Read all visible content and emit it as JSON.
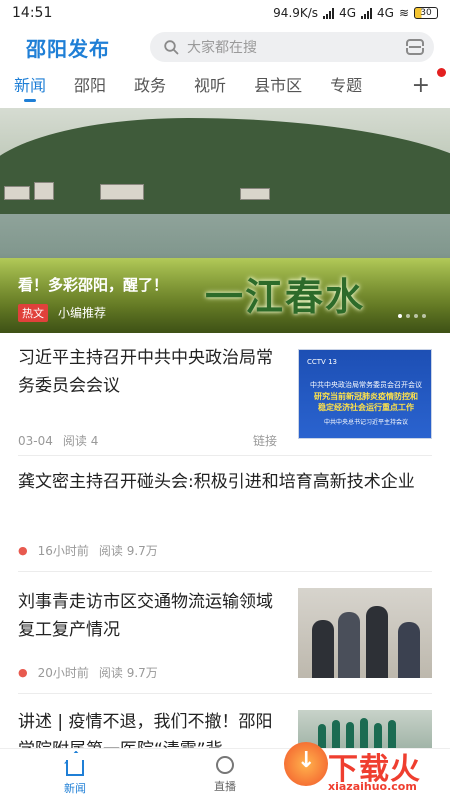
{
  "status_bar": {
    "time": "14:51",
    "speed": "94.9K/s",
    "network_1": "4G",
    "network_2": "4G",
    "battery": "30"
  },
  "header": {
    "app_name": "邵阳发布",
    "search_placeholder": "大家都在搜",
    "search_icon": "search-icon",
    "scan_icon": "scan-icon"
  },
  "tabs": {
    "items": [
      "新闻",
      "邵阳",
      "政务",
      "视听",
      "县市区",
      "专题"
    ],
    "active": "新闻",
    "add_label": "+"
  },
  "banner": {
    "caption": "看！多彩邵阳，醒了！",
    "overlay_text": "一江春水",
    "badge": "热文",
    "source": "小编推荐"
  },
  "news": [
    {
      "title": "习近平主持召开中共中央政治局常务委员会会议",
      "date": "03-04",
      "reads": "阅读 4",
      "tag": "链接",
      "thumb_line1": "CCTV 13",
      "thumb_line2": "中共中央政治局常务委员会召开会议",
      "thumb_line3": "研究当前新冠肺炎疫情防控和",
      "thumb_line4": "稳定经济社会运行重点工作",
      "thumb_line5": "中共中央总书记习近平主持会议"
    },
    {
      "title": "龚文密主持召开碰头会:积极引进和培育高新技术企业",
      "time": "16小时前",
      "reads": "阅读 9.7万"
    },
    {
      "title": "刘事青走访市区交通物流运输领域复工复产情况",
      "time": "20小时前",
      "reads": "阅读 9.7万"
    },
    {
      "title": "讲述 | 疫情不退，我们不撤！邵阳学院附属第一医院“清零”背"
    }
  ],
  "bottom_nav": {
    "items": [
      "新闻",
      "直播"
    ]
  },
  "watermark": {
    "name": "下载火",
    "url": "xiazaihuo.com"
  },
  "colors": {
    "brand": "#1f7fd6",
    "hot": "#e0413b",
    "watermark": "#ef3e2f"
  }
}
